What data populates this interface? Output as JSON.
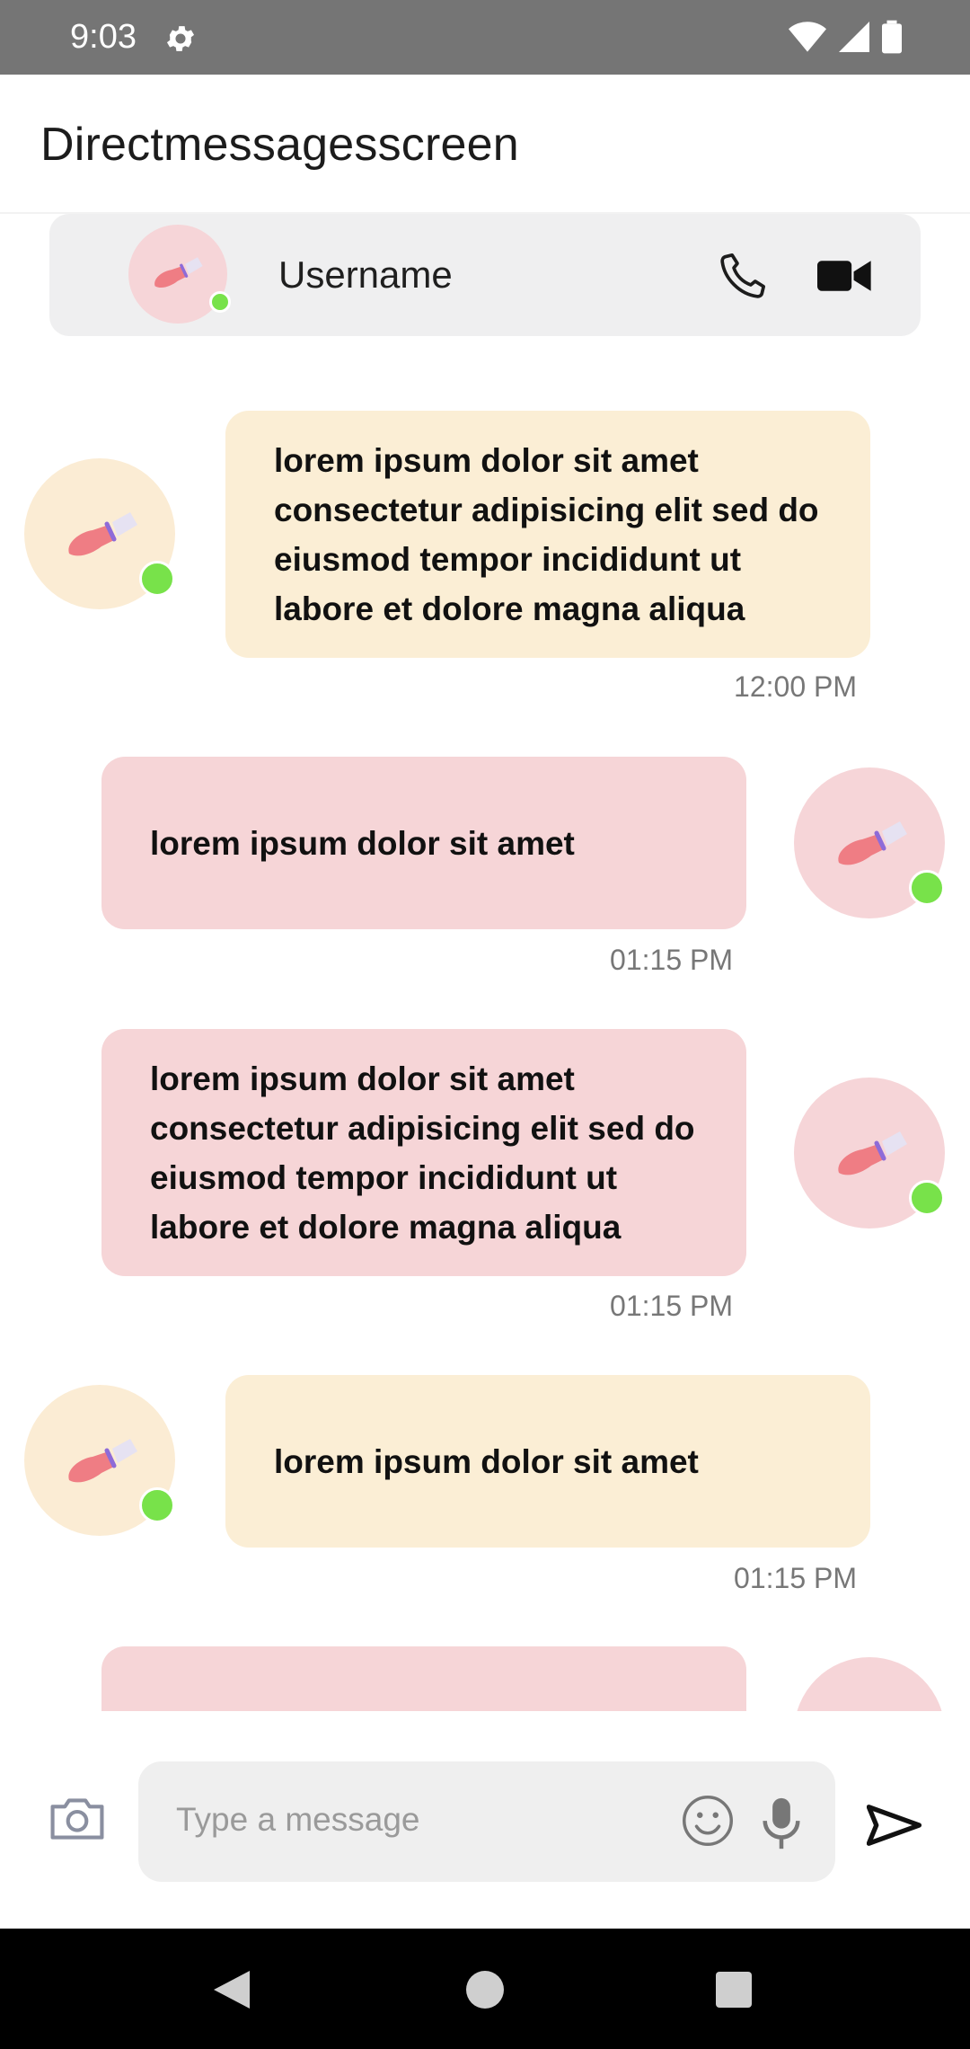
{
  "status_bar": {
    "time": "9:03",
    "icons": [
      "gear-icon",
      "wifi-icon",
      "signal-icon",
      "battery-icon"
    ]
  },
  "app_bar": {
    "title": "Directmessagesscreen"
  },
  "chat_header": {
    "username": "Username",
    "online": true,
    "actions": [
      "phone-icon",
      "video-camera-icon"
    ]
  },
  "messages": [
    {
      "side": "left",
      "color": "yellow",
      "text": "lorem ipsum dolor sit amet consectetur adipisicing elit sed do eiusmod tempor incididunt ut labore et dolore magna aliqua",
      "time": "12:00 PM"
    },
    {
      "side": "right",
      "color": "pink",
      "text": "lorem ipsum dolor sit amet",
      "time": "01:15 PM"
    },
    {
      "side": "right",
      "color": "pink",
      "text": "lorem ipsum dolor sit amet consectetur adipisicing elit sed do eiusmod tempor incididunt ut labore et dolore magna aliqua",
      "time": "01:15 PM"
    },
    {
      "side": "left",
      "color": "yellow",
      "text": "lorem ipsum dolor sit amet",
      "time": "01:15 PM"
    }
  ],
  "composer": {
    "placeholder": "Type a message",
    "value": ""
  },
  "colors": {
    "online": "#78e24a",
    "incoming_bubble": "#fbeed5",
    "outgoing_bubble": "#f6d5d7",
    "status_bar": "#757575"
  },
  "nav_bar": {
    "buttons": [
      "back-icon",
      "home-icon",
      "recents-icon"
    ]
  }
}
